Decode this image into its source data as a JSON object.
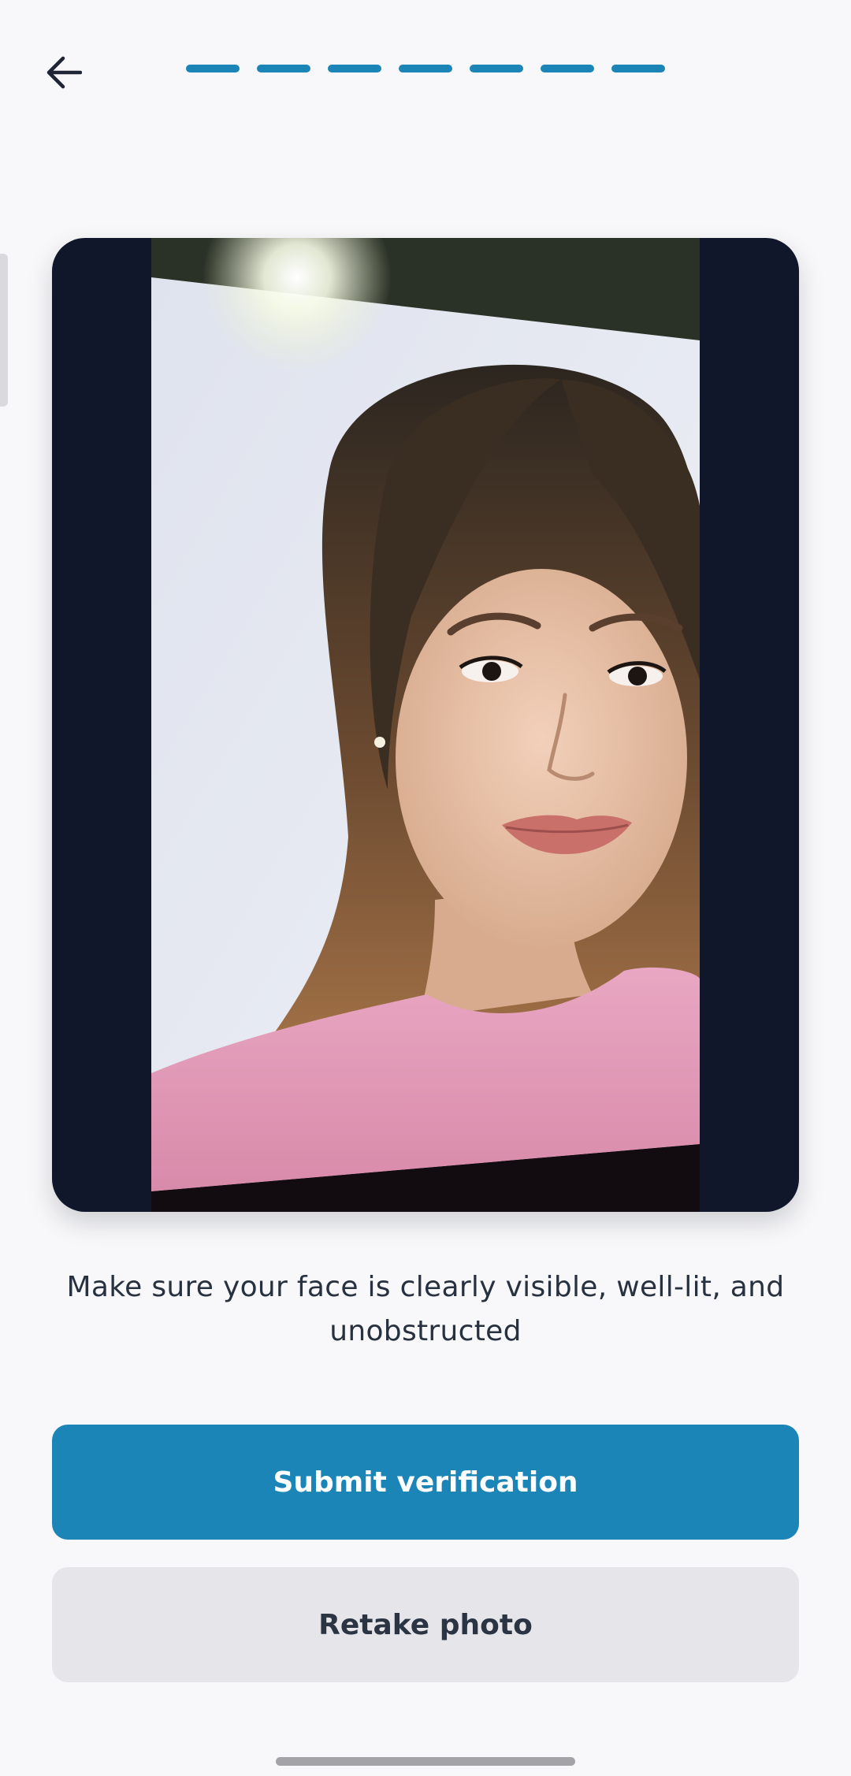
{
  "header": {
    "back_icon": "arrow-left-icon",
    "progress_steps": 7,
    "progress_color": "#1b85b8"
  },
  "preview": {
    "photo_icon": "selfie-photo"
  },
  "instruction": {
    "text": "Make sure your face is clearly visible, well-lit, and unobstructed"
  },
  "actions": {
    "submit_label": "Submit verification",
    "retake_label": "Retake photo"
  },
  "colors": {
    "primary": "#1b85b8",
    "secondary_bg": "#e6e6ea",
    "card_bg": "#11172a",
    "page_bg": "#f8f8fa"
  }
}
